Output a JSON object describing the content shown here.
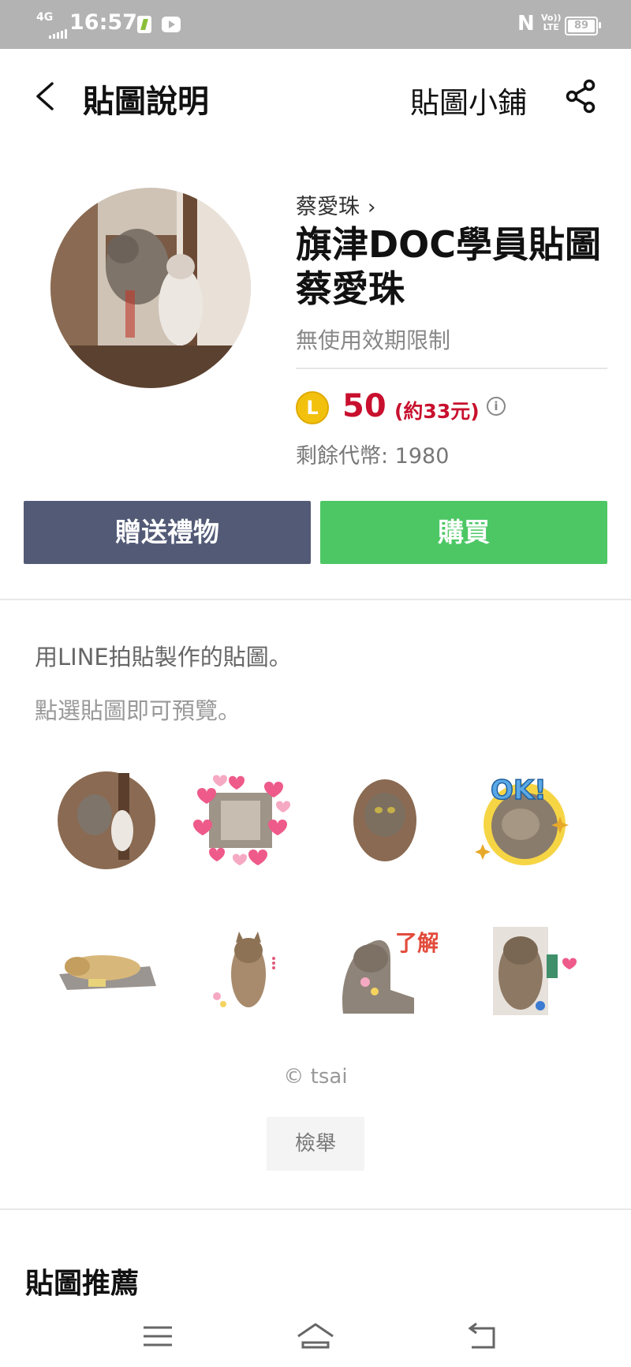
{
  "status_bar": {
    "network": "4G",
    "time": "16:57",
    "volte_line1": "Vo))",
    "volte_line2": "LTE",
    "battery": "89",
    "nfc": "N"
  },
  "header": {
    "title": "貼圖說明",
    "shop_link": "貼圖小鋪"
  },
  "product": {
    "author": "蔡愛珠",
    "title": "旗津DOC學員貼圖蔡愛珠",
    "validity": "無使用效期限制",
    "coin_letter": "L",
    "price": "50",
    "price_approx": "(約33元)",
    "info_icon": "i",
    "coins_left": "剩餘代幣: 1980"
  },
  "buttons": {
    "gift": "贈送禮物",
    "buy": "購買"
  },
  "description": {
    "line1": "用LINE拍貼製作的貼圖。",
    "line2": "點選貼圖即可預覽。"
  },
  "stickers": [
    {
      "name": "sticker-cats-tower",
      "caption": ""
    },
    {
      "name": "sticker-hearts-frame",
      "caption": ""
    },
    {
      "name": "sticker-oval-cat",
      "caption": ""
    },
    {
      "name": "sticker-ok",
      "caption": "OK!"
    },
    {
      "name": "sticker-sleeping-cat",
      "caption": ""
    },
    {
      "name": "sticker-sitting-cat",
      "caption": ""
    },
    {
      "name": "sticker-understand",
      "caption": "了解"
    },
    {
      "name": "sticker-thanks",
      "caption": ""
    }
  ],
  "copyright": "© tsai",
  "report_button": "檢舉",
  "recommend_title": "貼圖推薦",
  "colors": {
    "status_bar": "#b3b3b3",
    "gift_button": "#525a76",
    "buy_button": "#4cc764",
    "price": "#c8102e",
    "coin": "#f2c10e"
  },
  "icons": [
    "back-arrow-icon",
    "share-icon",
    "coin-icon",
    "info-icon",
    "menu-icon",
    "home-icon",
    "return-icon"
  ]
}
